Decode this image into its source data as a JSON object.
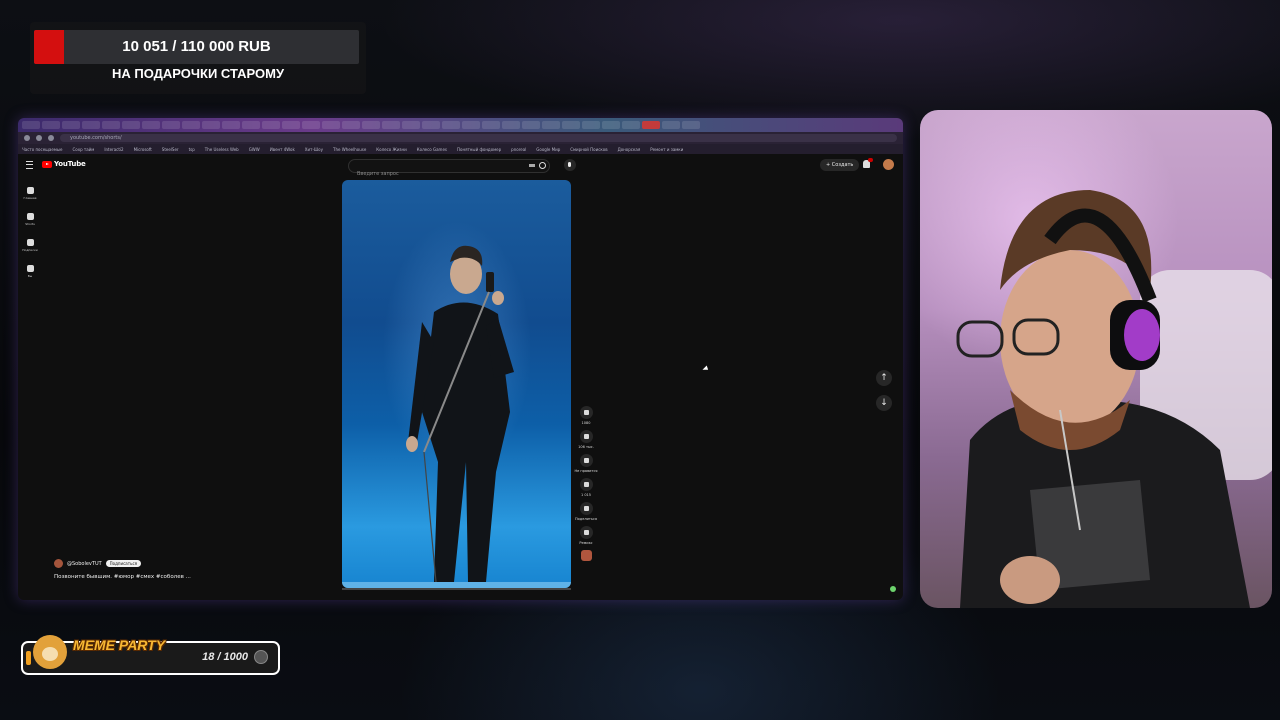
{
  "donation": {
    "amount": "10 051 / 110 000 RUB",
    "goal_text": "НА ПОДАРОЧКИ СТАРОМУ",
    "progress": 0.0914,
    "bar_color": "#d40f0f"
  },
  "browser": {
    "url": "youtube.com/shorts/",
    "bookmarks": [
      "Часто посещаемые",
      "Сохр тайм",
      "Interacti2",
      "Microsoft",
      "SteelSer",
      "tsp",
      "The Useless Web",
      "GWW",
      "Ивент 4Wok",
      "Хит-Шоу",
      "The Wheelhouse",
      "Колесо Жизни",
      "Колесо Games",
      "Понятный фондомер",
      "pnoreal",
      "Google Мир",
      "Смирной Поисков",
      "Донорская",
      "Ремонт и замки"
    ]
  },
  "youtube": {
    "logo_text": "YouTube",
    "search_placeholder": "Введите запрос",
    "create_label": "Создать",
    "sidebar": [
      {
        "label": "Главная",
        "icon": "home-icon"
      },
      {
        "label": "Shorts",
        "icon": "shorts-icon"
      },
      {
        "label": "Подписки",
        "icon": "subscriptions-icon"
      },
      {
        "label": "Вы",
        "icon": "you-icon"
      }
    ],
    "actions": {
      "like_count": "106 тыс.",
      "dislike_label": "Не нравится",
      "comment_count": "1 015",
      "share_label": "Поделиться",
      "remix_label": "Ремикс",
      "download_label": "1080"
    },
    "channel_name": "@SobolevTUT",
    "subscribe_label": "Подписаться",
    "video_title": "Позвоните бывшим. #юмор #смех #соболев ...",
    "video_progress": 0.0
  },
  "meme_party": {
    "title": "MEME PARTY",
    "count": "18 / 1000",
    "progress": 0.018
  }
}
